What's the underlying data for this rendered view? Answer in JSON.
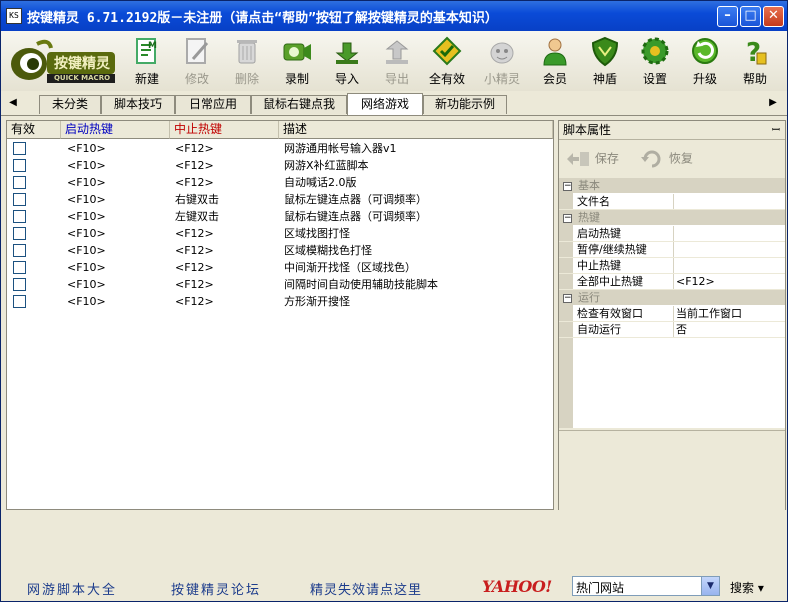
{
  "window": {
    "title": "按键精灵 6.71.2192版－未注册（请点击“帮助”按钮了解按键精灵的基本知识）",
    "app_icon_text": "KS"
  },
  "logo": {
    "main": "按键精灵",
    "sub": "QUICK MACRO"
  },
  "toolbar": [
    {
      "id": "new",
      "label": "新建",
      "enabled": true,
      "icon": "new-file-icon"
    },
    {
      "id": "edit",
      "label": "修改",
      "enabled": false,
      "icon": "edit-icon"
    },
    {
      "id": "delete",
      "label": "删除",
      "enabled": false,
      "icon": "trash-icon"
    },
    {
      "id": "record",
      "label": "录制",
      "enabled": true,
      "icon": "camera-icon"
    },
    {
      "id": "import",
      "label": "导入",
      "enabled": true,
      "icon": "import-arrow-icon"
    },
    {
      "id": "export",
      "label": "导出",
      "enabled": false,
      "icon": "export-arrow-icon"
    },
    {
      "id": "all-valid",
      "label": "全有效",
      "enabled": true,
      "icon": "diamond-check-icon"
    },
    {
      "id": "sprite",
      "label": "小精灵",
      "enabled": false,
      "icon": "sprite-icon"
    },
    {
      "id": "member",
      "label": "会员",
      "enabled": true,
      "icon": "person-icon"
    },
    {
      "id": "shield",
      "label": "神盾",
      "enabled": true,
      "icon": "shield-icon"
    },
    {
      "id": "settings",
      "label": "设置",
      "enabled": true,
      "icon": "gear-icon"
    },
    {
      "id": "upgrade",
      "label": "升级",
      "enabled": true,
      "icon": "refresh-icon"
    },
    {
      "id": "help",
      "label": "帮助",
      "enabled": true,
      "icon": "help-icon"
    }
  ],
  "tabs": [
    {
      "label": "未分类",
      "active": false
    },
    {
      "label": "脚本技巧",
      "active": false
    },
    {
      "label": "日常应用",
      "active": false
    },
    {
      "label": "鼠标右键点我",
      "active": false
    },
    {
      "label": "网络游戏",
      "active": true
    },
    {
      "label": "新功能示例",
      "active": false
    }
  ],
  "list": {
    "columns": [
      "有效",
      "启动热键",
      "中止热键",
      "描述"
    ],
    "rows": [
      {
        "start": "<F10>",
        "stop": "<F12>",
        "desc": "网游通用帐号输入器v1"
      },
      {
        "start": "<F10>",
        "stop": "<F12>",
        "desc": "网游X补红蓝脚本"
      },
      {
        "start": "<F10>",
        "stop": "<F12>",
        "desc": "自动喊话2.0版"
      },
      {
        "start": "<F10>",
        "stop": "右键双击",
        "desc": "鼠标左键连点器（可调频率）"
      },
      {
        "start": "<F10>",
        "stop": "左键双击",
        "desc": "鼠标右键连点器（可调频率）"
      },
      {
        "start": "<F10>",
        "stop": "<F12>",
        "desc": "区域找图打怪"
      },
      {
        "start": "<F10>",
        "stop": "<F12>",
        "desc": "区域模糊找色打怪"
      },
      {
        "start": "<F10>",
        "stop": "<F12>",
        "desc": "中间渐开找怪（区域找色）"
      },
      {
        "start": "<F10>",
        "stop": "<F12>",
        "desc": "间隔时间自动使用辅助技能脚本"
      },
      {
        "start": "<F10>",
        "stop": "<F12>",
        "desc": "方形渐开搜怪"
      }
    ]
  },
  "props": {
    "title": "脚本属性",
    "pin": "ꟷ",
    "save": "保存",
    "restore": "恢复",
    "sections": [
      {
        "name": "基本",
        "items": [
          {
            "k": "文件名",
            "v": ""
          }
        ]
      },
      {
        "name": "热键",
        "items": [
          {
            "k": "启动热键",
            "v": ""
          },
          {
            "k": "暂停/继续热键",
            "v": ""
          },
          {
            "k": "中止热键",
            "v": ""
          },
          {
            "k": "全部中止热键",
            "v": "<F12>"
          }
        ]
      },
      {
        "name": "运行",
        "items": [
          {
            "k": "检查有效窗口",
            "v": "当前工作窗口"
          },
          {
            "k": "自动运行",
            "v": "否"
          }
        ]
      }
    ]
  },
  "bottom": {
    "link1": "网游脚本大全",
    "link2": "按键精灵论坛",
    "link3": "精灵失效请点这里",
    "yahoo": "YAHOO!",
    "search_select": "热门网站",
    "search_button": "搜索 ▾"
  },
  "colors": {
    "title_bar": "#0a4bd8",
    "header_red": "#c00000",
    "header_blue": "#0000c0",
    "link_blue": "#1c3c8c",
    "yahoo_red": "#c81e1e"
  }
}
